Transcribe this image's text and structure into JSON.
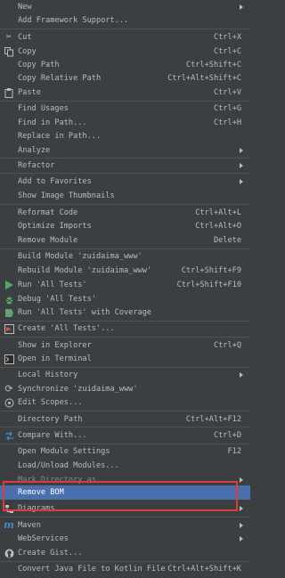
{
  "items": [
    {
      "label": "New",
      "shortcut": "",
      "icon": "",
      "submenu": true
    },
    {
      "label": "Add Framework Support...",
      "shortcut": "",
      "icon": "",
      "submenu": false
    },
    {
      "label": "Cut",
      "shortcut": "Ctrl+X",
      "icon": "scissors-icon",
      "submenu": false
    },
    {
      "label": "Copy",
      "shortcut": "Ctrl+C",
      "icon": "copy-icon",
      "submenu": false
    },
    {
      "label": "Copy Path",
      "shortcut": "Ctrl+Shift+C",
      "icon": "",
      "submenu": false
    },
    {
      "label": "Copy Relative Path",
      "shortcut": "Ctrl+Alt+Shift+C",
      "icon": "",
      "submenu": false
    },
    {
      "label": "Paste",
      "shortcut": "Ctrl+V",
      "icon": "paste-icon",
      "submenu": false
    },
    {
      "label": "Find Usages",
      "shortcut": "Ctrl+G",
      "icon": "",
      "submenu": false
    },
    {
      "label": "Find in Path...",
      "shortcut": "Ctrl+H",
      "icon": "",
      "submenu": false
    },
    {
      "label": "Replace in Path...",
      "shortcut": "",
      "icon": "",
      "submenu": false
    },
    {
      "label": "Analyze",
      "shortcut": "",
      "icon": "",
      "submenu": true
    },
    {
      "label": "Refactor",
      "shortcut": "",
      "icon": "",
      "submenu": true
    },
    {
      "label": "Add to Favorites",
      "shortcut": "",
      "icon": "",
      "submenu": true
    },
    {
      "label": "Show Image Thumbnails",
      "shortcut": "",
      "icon": "",
      "submenu": false
    },
    {
      "label": "Reformat Code",
      "shortcut": "Ctrl+Alt+L",
      "icon": "",
      "submenu": false
    },
    {
      "label": "Optimize Imports",
      "shortcut": "Ctrl+Alt+O",
      "icon": "",
      "submenu": false
    },
    {
      "label": "Remove Module",
      "shortcut": "Delete",
      "icon": "",
      "submenu": false
    },
    {
      "label": "Build Module 'zuidaima_www'",
      "shortcut": "",
      "icon": "",
      "submenu": false
    },
    {
      "label": "Rebuild Module 'zuidaima_www'",
      "shortcut": "Ctrl+Shift+F9",
      "icon": "",
      "submenu": false
    },
    {
      "label": "Run 'All Tests'",
      "shortcut": "Ctrl+Shift+F10",
      "icon": "run-icon",
      "submenu": false
    },
    {
      "label": "Debug 'All Tests'",
      "shortcut": "",
      "icon": "debug-icon",
      "submenu": false
    },
    {
      "label": "Run 'All Tests' with Coverage",
      "shortcut": "",
      "icon": "coverage-icon",
      "submenu": false
    },
    {
      "label": "Create 'All Tests'...",
      "shortcut": "",
      "icon": "test-config-icon",
      "submenu": false
    },
    {
      "label": "Show in Explorer",
      "shortcut": "Ctrl+Q",
      "icon": "",
      "submenu": false
    },
    {
      "label": "Open in Terminal",
      "shortcut": "",
      "icon": "terminal-icon",
      "submenu": false
    },
    {
      "label": "Local History",
      "shortcut": "",
      "icon": "",
      "submenu": true
    },
    {
      "label": "Synchronize 'zuidaima_www'",
      "shortcut": "",
      "icon": "sync-icon",
      "submenu": false
    },
    {
      "label": "Edit Scopes...",
      "shortcut": "",
      "icon": "scopes-icon",
      "submenu": false
    },
    {
      "label": "Directory Path",
      "shortcut": "Ctrl+Alt+F12",
      "icon": "",
      "submenu": false
    },
    {
      "label": "Compare With...",
      "shortcut": "Ctrl+D",
      "icon": "compare-icon",
      "submenu": false
    },
    {
      "label": "Open Module Settings",
      "shortcut": "F12",
      "icon": "",
      "submenu": false
    },
    {
      "label": "Load/Unload Modules...",
      "shortcut": "",
      "icon": "",
      "submenu": false
    },
    {
      "label": "Mark Directory as",
      "shortcut": "",
      "icon": "",
      "submenu": true
    },
    {
      "label": "Remove BOM",
      "shortcut": "",
      "icon": "",
      "submenu": false
    },
    {
      "label": "Diagrams",
      "shortcut": "",
      "icon": "diagram-icon",
      "submenu": true
    },
    {
      "label": "Maven",
      "shortcut": "",
      "icon": "maven-icon",
      "submenu": true
    },
    {
      "label": "WebServices",
      "shortcut": "",
      "icon": "",
      "submenu": true
    },
    {
      "label": "Create Gist...",
      "shortcut": "",
      "icon": "github-icon",
      "submenu": false
    },
    {
      "label": "Convert Java File to Kotlin File",
      "shortcut": "Ctrl+Alt+Shift+K",
      "icon": "",
      "submenu": false
    }
  ],
  "selected_label": "Remove BOM",
  "colors": {
    "background": "#3c3f41",
    "text": "#bbbbbb",
    "selection": "#4b6eaf",
    "separator": "#515151",
    "highlight_box": "#e03a3a"
  }
}
